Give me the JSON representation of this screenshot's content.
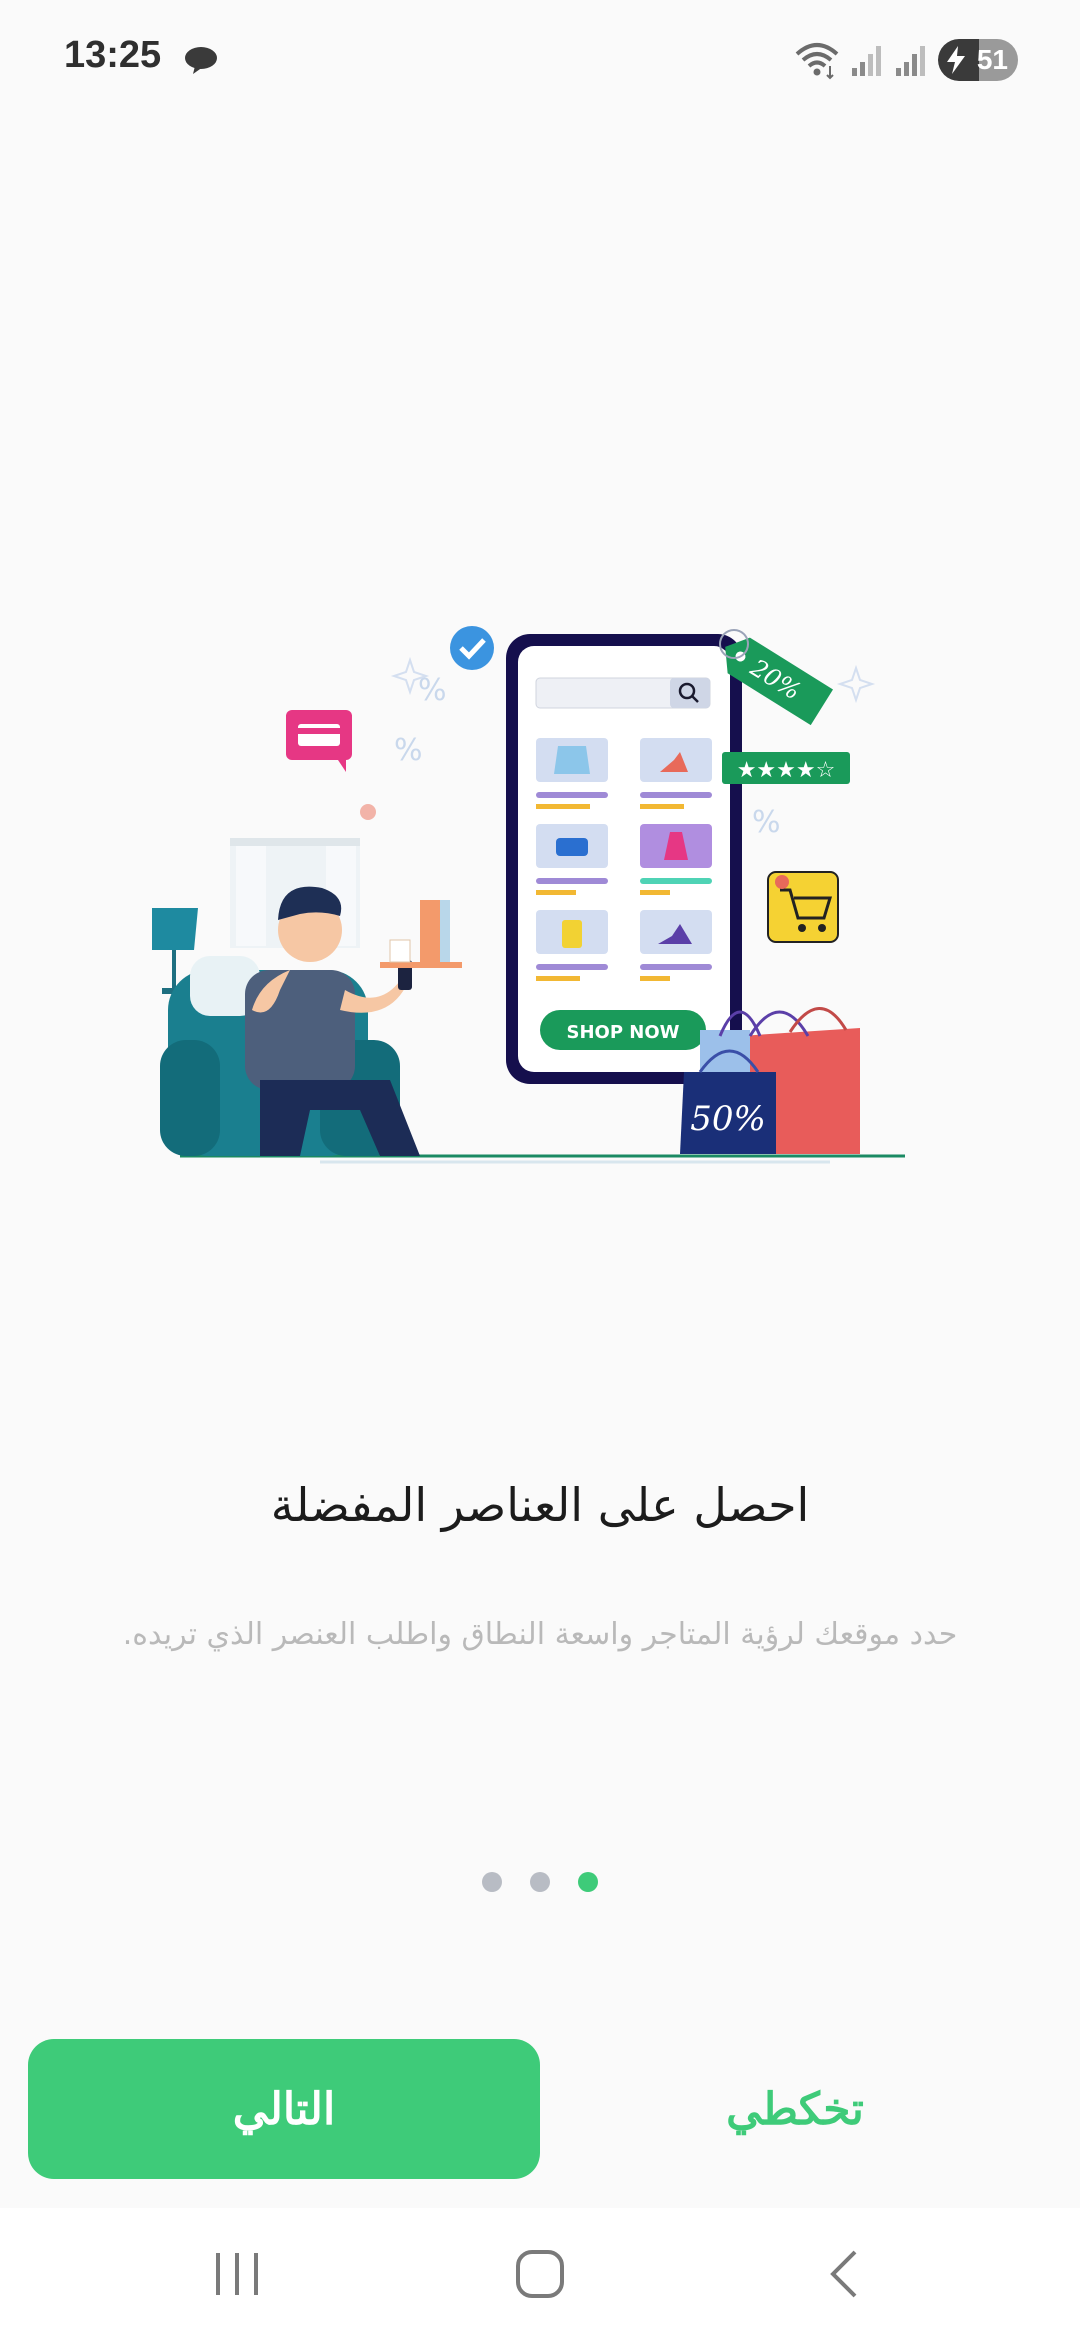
{
  "status_bar": {
    "time": "13:25",
    "battery_level": "51",
    "icons": [
      "chat-bubble-icon",
      "wifi-icon",
      "signal-icon",
      "signal-icon",
      "battery-charging-icon"
    ]
  },
  "illustration": {
    "shop_button_label": "SHOP NOW",
    "discount_tag": "20%",
    "bag_label": "50%",
    "percent_sign": "%"
  },
  "onboarding": {
    "title": "احصل على العناصر المفضلة",
    "description": "حدد موقعك لرؤية المتاجر واسعة النطاق واطلب العنصر الذي تريده.",
    "page_count": 3,
    "current_page": 3
  },
  "actions": {
    "next_label": "التالي",
    "skip_label": "تخكطي"
  },
  "colors": {
    "accent": "#3ecb79",
    "background": "#fafafa"
  },
  "nav_bar": {
    "icons": [
      "recent-apps-icon",
      "home-icon",
      "back-icon"
    ]
  }
}
